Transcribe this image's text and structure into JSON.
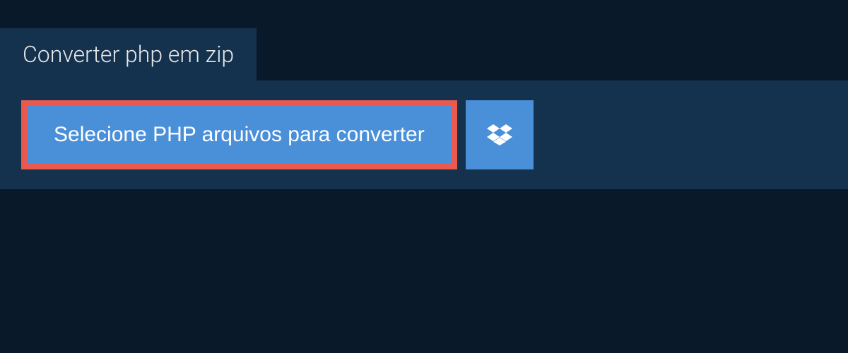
{
  "tab": {
    "title": "Converter php em zip"
  },
  "actions": {
    "select_files_label": "Selecione PHP arquivos para converter"
  }
}
